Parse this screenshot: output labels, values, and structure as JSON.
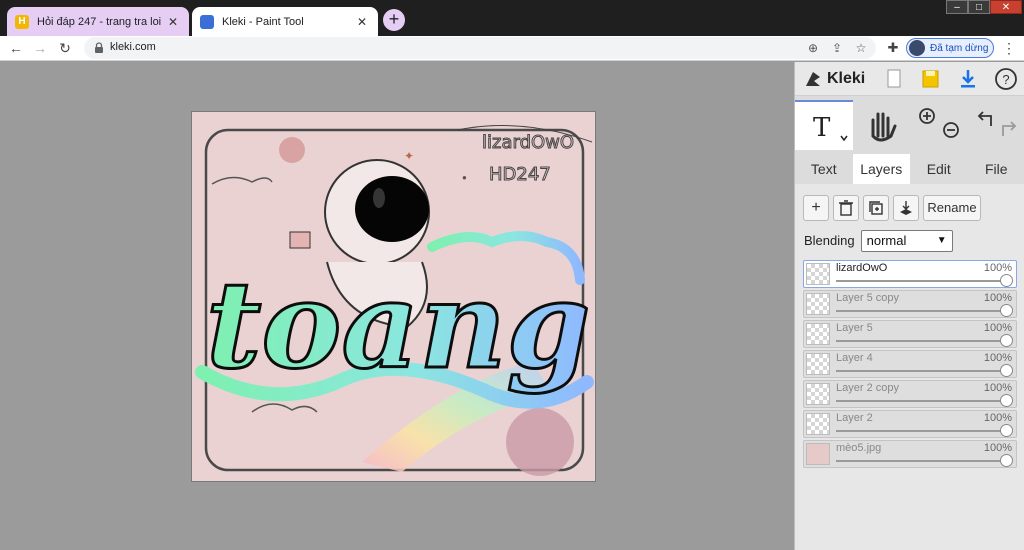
{
  "browser": {
    "tabs": [
      {
        "title": "Hỏi đáp 247 - trang tra loi",
        "favicon_color": "#f2b705"
      },
      {
        "title": "Kleki - Paint Tool",
        "favicon_color": "#3b6fd8"
      }
    ],
    "new_tab": "+",
    "window_controls": {
      "minimize": "–",
      "maximize": "□",
      "close": "✕"
    },
    "address": {
      "url": "kleki.com"
    },
    "profile_status": "Đã tạm dừng"
  },
  "app": {
    "name": "Kleki",
    "panel_tabs": [
      "Text",
      "Layers",
      "Edit",
      "File"
    ],
    "active_tab": "Layers",
    "layer_buttons": {
      "add": "+",
      "rename": "Rename"
    },
    "blending": {
      "label": "Blending",
      "value": "normal"
    },
    "layers": [
      {
        "name": "lizardOwO",
        "opacity": "100%"
      },
      {
        "name": "Layer 5 copy",
        "opacity": "100%"
      },
      {
        "name": "Layer 5",
        "opacity": "100%"
      },
      {
        "name": "Layer 4",
        "opacity": "100%"
      },
      {
        "name": "Layer 2 copy",
        "opacity": "100%"
      },
      {
        "name": "Layer 2",
        "opacity": "100%"
      },
      {
        "name": "mèo5.jpg",
        "opacity": "100%"
      }
    ]
  },
  "artwork": {
    "watermark_line1": "lizardOwO",
    "watermark_line2": "HD247",
    "title_word": "toang"
  },
  "colors": {
    "accent": "#6b8ad8",
    "canvas_bg": "#9b9b9b",
    "art_bg": "#ebd2d2"
  }
}
